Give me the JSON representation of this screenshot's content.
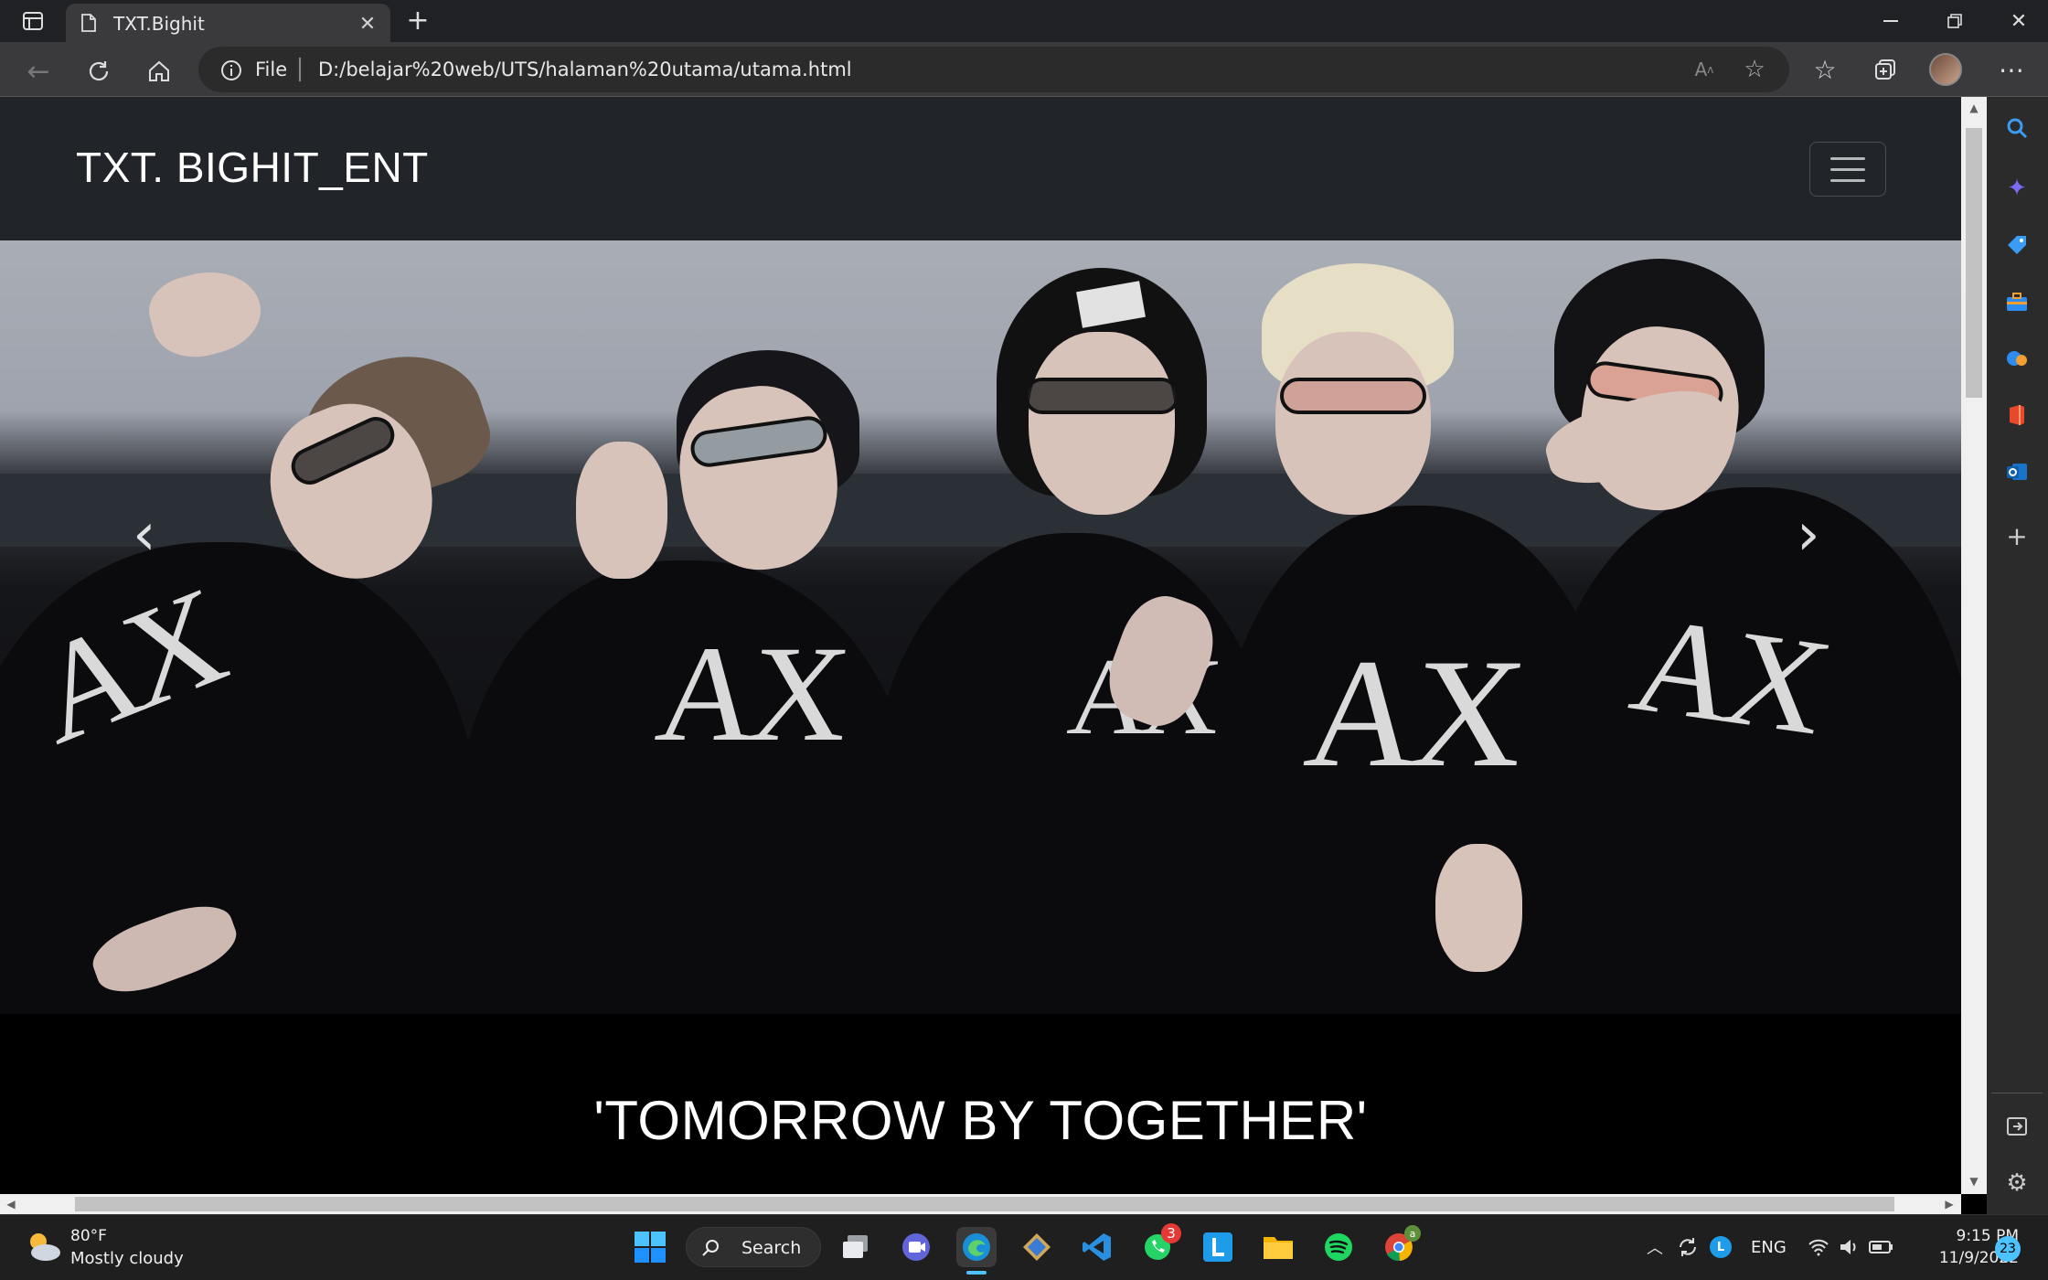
{
  "browser": {
    "tab_title": "TXT.Bighit",
    "new_tab_symbol": "+",
    "address_info_label": "File",
    "address_url": "D:/belajar%20web/UTS/halaman%20utama/utama.html"
  },
  "site": {
    "brand": "TXT. BIGHIT_ENT",
    "carousel_prev_symbol": "‹",
    "carousel_next_symbol": "›",
    "heading": "'TOMORROW BY TOGETHER'",
    "logo_text": "AX"
  },
  "taskbar": {
    "weather_temp": "80°F",
    "weather_desc": "Mostly cloudy",
    "search_label": "Search",
    "whatsapp_badge": "3",
    "chrome_badge": "a",
    "language": "ENG",
    "time": "9:15 PM",
    "date": "11/9/2022",
    "notification_count": "23"
  },
  "icons": {
    "sidebar": [
      "search-icon",
      "sparkle-icon",
      "tag-icon",
      "toolbox-icon",
      "games-icon",
      "office-icon",
      "outlook-icon",
      "add-icon"
    ],
    "colors": {
      "edge_blue": "#2d8cf0",
      "navbar": "#212529",
      "taskbar": "#1f1f1f"
    }
  }
}
